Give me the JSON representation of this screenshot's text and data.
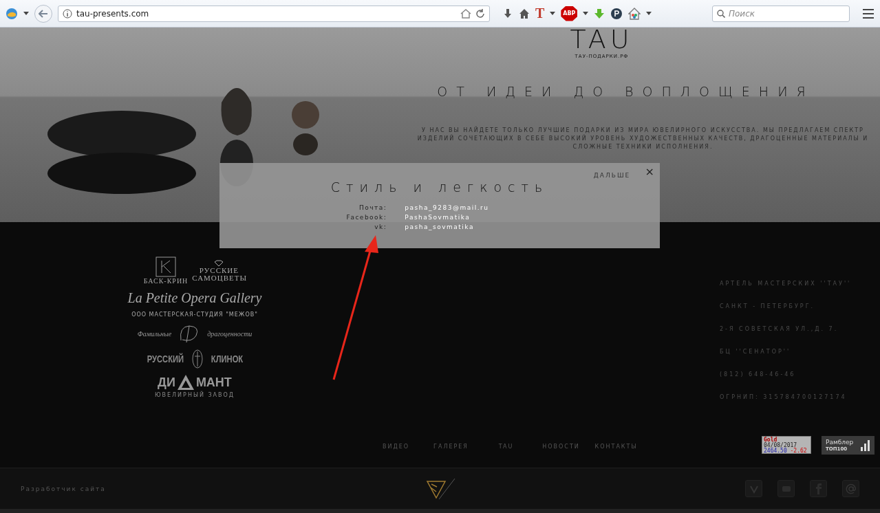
{
  "browser": {
    "url": "tau-presents.com",
    "search_placeholder": "Поиск",
    "abp_badge": "ABP",
    "t_button": "T"
  },
  "hero": {
    "logo": "TAU",
    "domain": "ТАУ-ПОДАРКИ.РФ",
    "headline": "ОТ ИДЕИ ДО ВОПЛОЩЕНИЯ",
    "intro": "У НАС ВЫ НАЙДЕТЕ ТОЛЬКО ЛУЧШИЕ ПОДАРКИ ИЗ МИРА ЮВЕЛИРНОГО ИСКУССТВА. МЫ ПРЕДЛАГАЕМ СПЕКТР ИЗДЕЛИЙ СОЧЕТАЮЩИХ В СЕБЕ ВЫСОКИЙ УРОВЕНЬ ХУДОЖЕСТВЕННЫХ КАЧЕСТВ, ДРАГОЦЕННЫЕ МАТЕРИАЛЫ И СЛОЖНЫЕ ТЕХНИКИ ИСПОЛНЕНИЯ.",
    "more": "ДАЛЬШЕ"
  },
  "modal": {
    "title": "Стиль и легкость",
    "close": "×",
    "contacts": [
      {
        "label": "Почта:",
        "value": "pasha_9283@mail.ru"
      },
      {
        "label": "Facebook:",
        "value": "PashaSovmatika"
      },
      {
        "label": "vk:",
        "value": "pasha_sovmatika"
      }
    ]
  },
  "partners": {
    "bask_krin": "БАСК-КРИН",
    "samotsvety": "РУССКИЕ САМОЦВЕТЫ",
    "opera_gallery": "La Petite Opera Gallery",
    "mezhov": "ООО МАСТЕРСКАЯ-СТУДИЯ \"МЕЖОВ\"",
    "family_left": "Фамильные",
    "family_right": "драгоценности",
    "klinok_left": "РУССКИЙ",
    "klinok_right": "КЛИНОК",
    "diamant_left": "ДИ",
    "diamant_right": "МАНТ",
    "diamant_sub": "ЮВЕЛИРНЫЙ ЗАВОД"
  },
  "address": [
    "АРТЕЛЬ МАСТЕРСКИХ ''ТАУ''",
    "САНКТ - ПЕТЕРБУРГ.",
    "2-Я СОВЕТСКАЯ УЛ.,Д. 7.",
    "БЦ ''СЕНАТОР''",
    "(812) 648-46-46",
    "ОГРНИП: 315784700127174"
  ],
  "nav": [
    {
      "label": "ВИДЕО"
    },
    {
      "label": "ГАЛЕРЕЯ"
    },
    {
      "label": "TAU"
    },
    {
      "label": "НОВОСТИ"
    },
    {
      "label": "КОНТАКТЫ"
    }
  ],
  "gold_widget": {
    "title": "Gold",
    "date": "04/08/2017",
    "price": "2464.50",
    "change": "-2.62"
  },
  "rambler": {
    "name": "Рамблер",
    "sub": "ТОП100"
  },
  "bottom_bar": {
    "developer": "Разработчик сайта"
  }
}
